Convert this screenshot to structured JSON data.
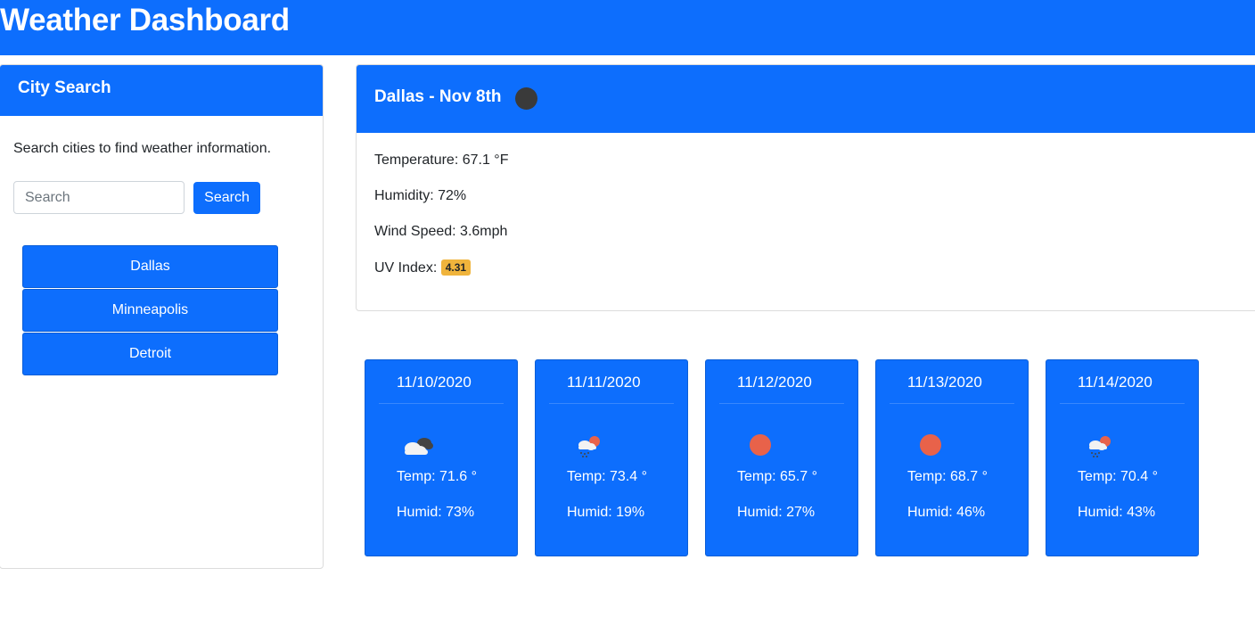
{
  "header": {
    "title": "Weather Dashboard"
  },
  "sidebar": {
    "title": "City Search",
    "description": "Search cities to find weather information.",
    "search": {
      "placeholder": "Search",
      "value": "",
      "button_label": "Search"
    },
    "history": [
      {
        "label": "Dallas"
      },
      {
        "label": "Minneapolis"
      },
      {
        "label": "Detroit"
      }
    ]
  },
  "current": {
    "title": "Dallas - Nov 8th",
    "icon": "moon-icon",
    "temperature": "Temperature: 67.1 °F",
    "humidity": "Humidity: 72%",
    "wind": "Wind Speed: 3.6mph",
    "uv_label": "UV Index:",
    "uv_value": "4.31"
  },
  "forecast": [
    {
      "date": "11/10/2020",
      "icon": "cloudy-icon",
      "temp": "Temp: 71.6 °",
      "humid": "Humid: 73%"
    },
    {
      "date": "11/11/2020",
      "icon": "rain-sun-icon",
      "temp": "Temp: 73.4 °",
      "humid": "Humid: 19%"
    },
    {
      "date": "11/12/2020",
      "icon": "sun-icon",
      "temp": "Temp: 65.7 °",
      "humid": "Humid: 27%"
    },
    {
      "date": "11/13/2020",
      "icon": "sun-icon",
      "temp": "Temp: 68.7 °",
      "humid": "Humid: 46%"
    },
    {
      "date": "11/14/2020",
      "icon": "rain-sun-icon",
      "temp": "Temp: 70.4 °",
      "humid": "Humid: 43%"
    }
  ],
  "colors": {
    "primary": "#0d6efd",
    "uv_badge": "#f0b43c",
    "sun": "#e8624a"
  }
}
